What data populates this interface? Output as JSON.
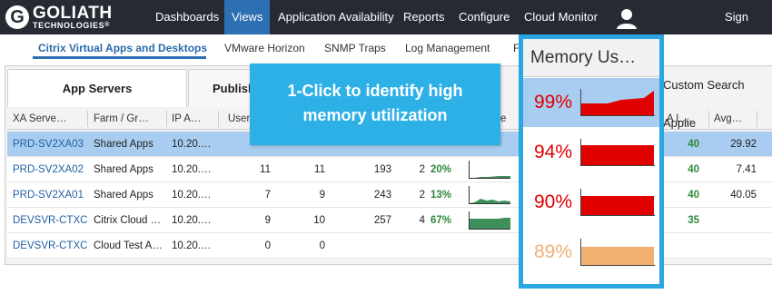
{
  "brand": {
    "logo_letter": "G",
    "name": "GOLIATH",
    "sub": "TECHNOLOGIES",
    "reg": "®"
  },
  "nav": {
    "items": [
      "Dashboards",
      "Views",
      "Application Availability",
      "Reports",
      "Configure",
      "Cloud Monitor"
    ],
    "active": "Views",
    "sign_out": "Sign Out"
  },
  "subnav": {
    "items": [
      "Citrix Virtual Apps and Desktops",
      "VMware Horizon",
      "SNMP Traps",
      "Log Management",
      "F"
    ],
    "active": "Citrix Virtual Apps and Desktops"
  },
  "tabs": {
    "app_servers": "App Servers",
    "published": "Publishe",
    "custom": "Custom Search Applie"
  },
  "table": {
    "headers": [
      "XA Serve…",
      "Farm / Gr…",
      "IP A…",
      "User",
      "e",
      "A L…",
      "Avg…"
    ],
    "rows": [
      {
        "server": "PRD-SV2XA03",
        "farm": "Shared Apps",
        "ip": "10.20.…",
        "c1": "",
        "c2": "",
        "c3": "",
        "c4": "",
        "pct": "",
        "spark": [],
        "al": "40",
        "avg": "29.92"
      },
      {
        "server": "PRD-SV2XA02",
        "farm": "Shared Apps",
        "ip": "10.20.…",
        "c1": "11",
        "c2": "11",
        "c3": "193",
        "c4": "2",
        "pct": "20%",
        "spark": [
          0.05,
          0.05,
          0.1,
          0.1,
          0.12,
          0.15,
          0.15,
          0.15
        ],
        "al": "40",
        "avg": "7.41"
      },
      {
        "server": "PRD-SV2XA01",
        "farm": "Shared Apps",
        "ip": "10.20.…",
        "c1": "7",
        "c2": "9",
        "c3": "243",
        "c4": "2",
        "pct": "13%",
        "spark": [
          0.05,
          0.1,
          0.3,
          0.2,
          0.25,
          0.15,
          0.2,
          0.15
        ],
        "al": "40",
        "avg": "40.05"
      },
      {
        "server": "DEVSVR-CTXC",
        "farm": "Citrix Cloud …",
        "ip": "10.20.…",
        "c1": "9",
        "c2": "10",
        "c3": "257",
        "c4": "4",
        "pct": "67%",
        "spark": [
          0.6,
          0.6,
          0.6,
          0.6,
          0.6,
          0.6,
          0.65,
          0.65
        ],
        "al": "35",
        "avg": ""
      },
      {
        "server": "DEVSVR-CTXC",
        "farm": "Cloud Test A…",
        "ip": "10.20.…",
        "c1": "0",
        "c2": "0",
        "c3": "",
        "c4": "",
        "pct": "",
        "spark": [],
        "al": "",
        "avg": ""
      }
    ]
  },
  "callout": {
    "line1": "1-Click to identify high",
    "line2": "memory utilization"
  },
  "memory": {
    "title": "Memory Us…",
    "rows": [
      {
        "value": "99%",
        "level": 0.99,
        "color": "#e00000",
        "fill": "#e00000",
        "text_color": "#e00000",
        "selected": true
      },
      {
        "value": "94%",
        "level": 0.94,
        "color": "#e00000",
        "fill": "#e00000",
        "text_color": "#e00000",
        "selected": false
      },
      {
        "value": "90%",
        "level": 0.9,
        "color": "#e00000",
        "fill": "#e00000",
        "text_color": "#e00000",
        "selected": false
      },
      {
        "value": "89%",
        "level": 0.89,
        "color": "#f0b070",
        "fill": "#f0b070",
        "text_color": "#f0b070",
        "selected": false
      }
    ]
  },
  "colors": {
    "nav_bg": "#262b33",
    "accent": "#2c6fb2",
    "callout": "#2db0e6",
    "selection": "#a9cdf0"
  }
}
